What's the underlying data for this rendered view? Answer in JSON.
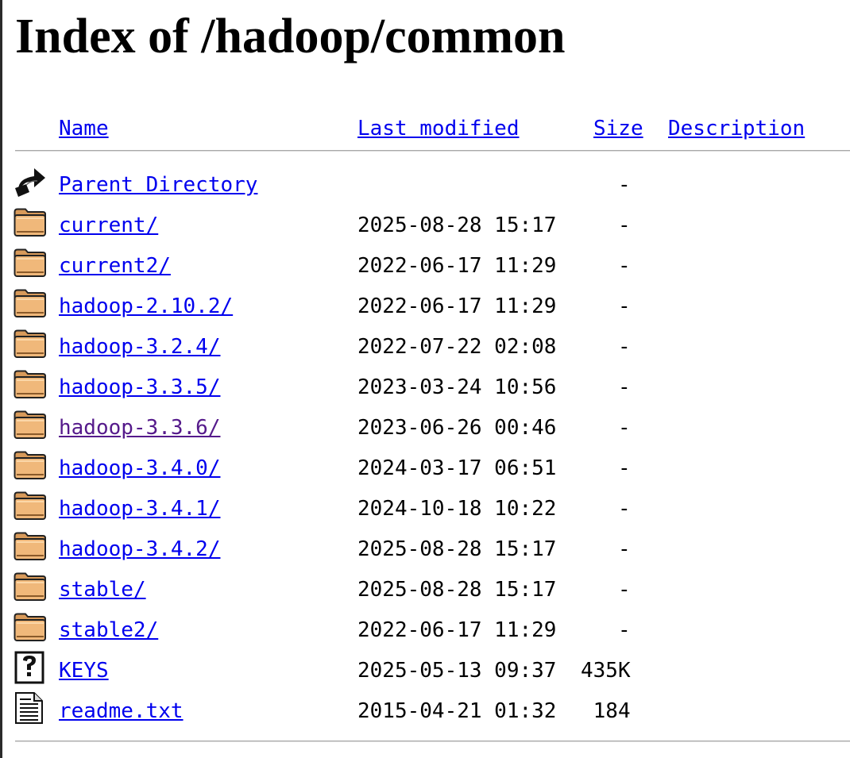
{
  "title": "Index of /hadoop/common",
  "columns": {
    "name": "Name",
    "last_modified": "Last modified",
    "size": "Size",
    "description": "Description"
  },
  "link_color": "#0000ee",
  "visited_link_color": "#551a8b",
  "entries": [
    {
      "icon": "back-icon",
      "name": "Parent Directory",
      "date": "",
      "size": "-",
      "visited": false
    },
    {
      "icon": "folder-icon",
      "name": "current/",
      "date": "2025-08-28 15:17",
      "size": "-",
      "visited": false
    },
    {
      "icon": "folder-icon",
      "name": "current2/",
      "date": "2022-06-17 11:29",
      "size": "-",
      "visited": false
    },
    {
      "icon": "folder-icon",
      "name": "hadoop-2.10.2/",
      "date": "2022-06-17 11:29",
      "size": "-",
      "visited": false
    },
    {
      "icon": "folder-icon",
      "name": "hadoop-3.2.4/",
      "date": "2022-07-22 02:08",
      "size": "-",
      "visited": false
    },
    {
      "icon": "folder-icon",
      "name": "hadoop-3.3.5/",
      "date": "2023-03-24 10:56",
      "size": "-",
      "visited": false
    },
    {
      "icon": "folder-icon",
      "name": "hadoop-3.3.6/",
      "date": "2023-06-26 00:46",
      "size": "-",
      "visited": true
    },
    {
      "icon": "folder-icon",
      "name": "hadoop-3.4.0/",
      "date": "2024-03-17 06:51",
      "size": "-",
      "visited": false
    },
    {
      "icon": "folder-icon",
      "name": "hadoop-3.4.1/",
      "date": "2024-10-18 10:22",
      "size": "-",
      "visited": false
    },
    {
      "icon": "folder-icon",
      "name": "hadoop-3.4.2/",
      "date": "2025-08-28 15:17",
      "size": "-",
      "visited": false
    },
    {
      "icon": "folder-icon",
      "name": "stable/",
      "date": "2025-08-28 15:17",
      "size": "-",
      "visited": false
    },
    {
      "icon": "folder-icon",
      "name": "stable2/",
      "date": "2022-06-17 11:29",
      "size": "-",
      "visited": false
    },
    {
      "icon": "unknown-file-icon",
      "name": "KEYS",
      "date": "2025-05-13 09:37",
      "size": "435K",
      "visited": false
    },
    {
      "icon": "text-file-icon",
      "name": "readme.txt",
      "date": "2015-04-21 01:32",
      "size": "184",
      "visited": false
    }
  ]
}
